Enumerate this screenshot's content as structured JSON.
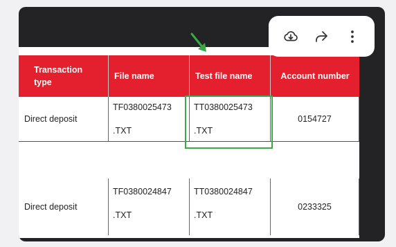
{
  "table": {
    "headers": [
      "Transaction type",
      "File name",
      "Test file name",
      "Account number"
    ],
    "rows": [
      {
        "type": "Direct deposit",
        "file_top": "TF0380025473",
        "file_bot": ".TXT",
        "test_top": "TT0380025473",
        "test_bot": ".TXT",
        "account": "0154727"
      },
      {
        "type": "Direct deposit",
        "file_top": "TF0380024847",
        "file_bot": ".TXT",
        "test_top": "TT0380024847",
        "test_bot": ".TXT",
        "account": "0233325"
      }
    ]
  },
  "toolbar": {
    "icons": [
      "download-icon",
      "share-icon",
      "more-vert-icon"
    ]
  },
  "colors": {
    "header_red": "#e5202e",
    "highlight_green": "#3aa945",
    "frame_dark": "#232326"
  }
}
